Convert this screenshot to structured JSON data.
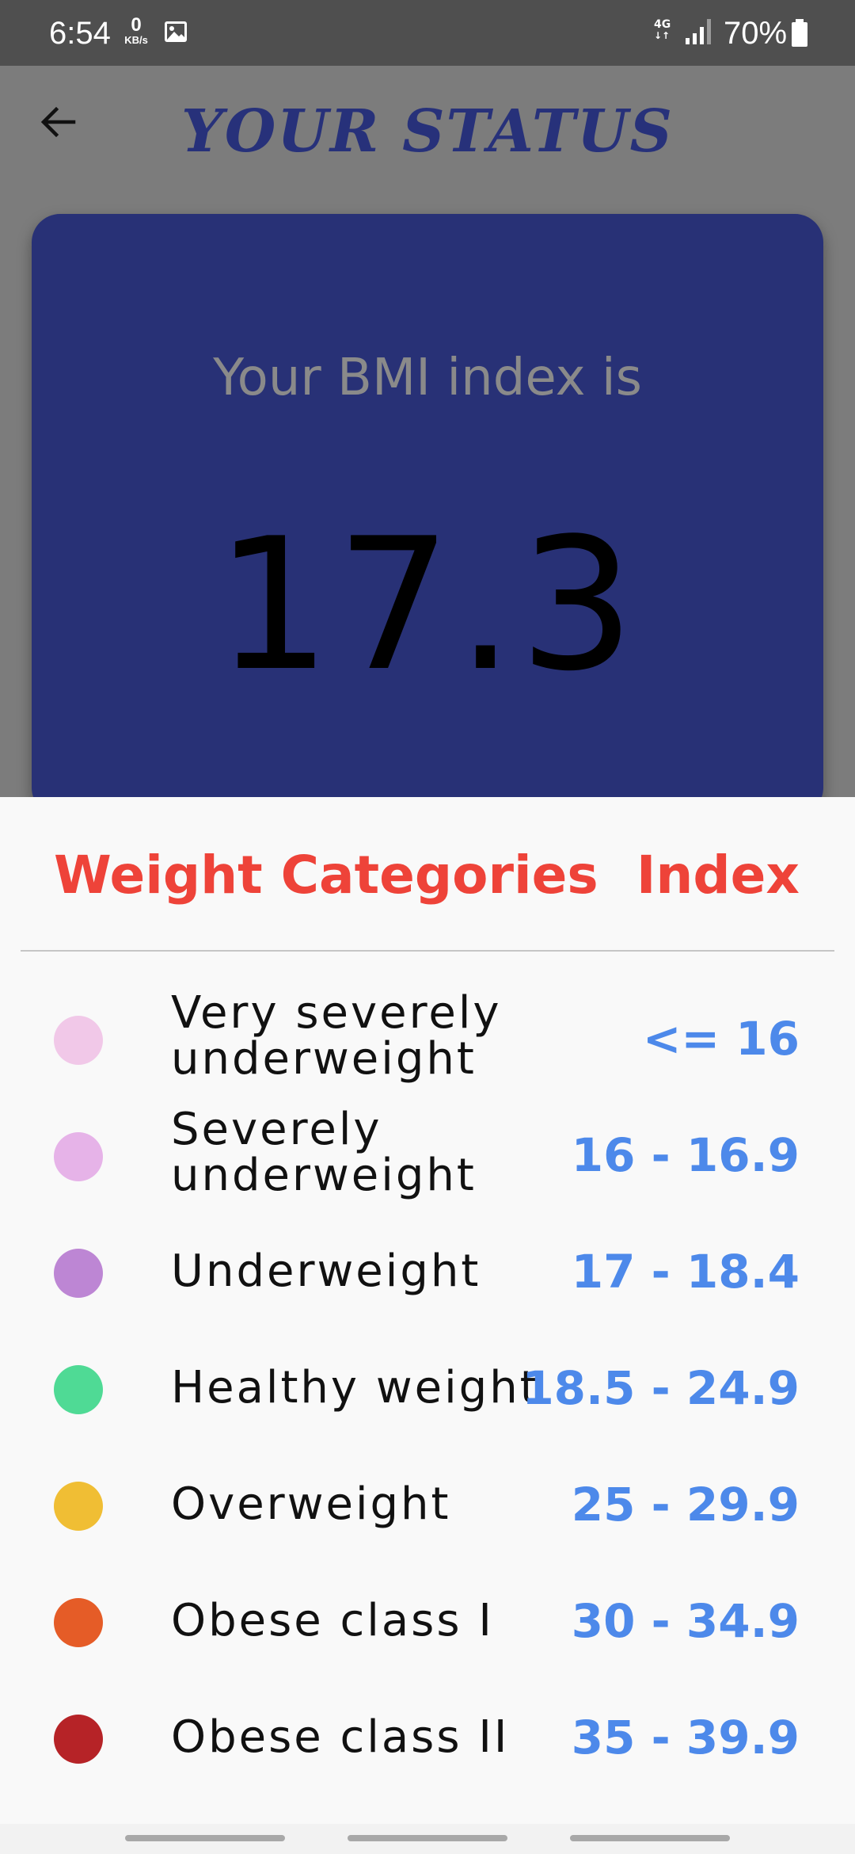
{
  "status_bar": {
    "time": "6:54",
    "net_speed_value": "0",
    "net_speed_unit": "KB/s",
    "network_type": "4G",
    "battery": "70%"
  },
  "app_bar": {
    "title": "YOUR STATUS",
    "back_icon": "arrow-back-icon"
  },
  "result": {
    "label": "Your BMI index is",
    "value": "17.3"
  },
  "categories_sheet": {
    "header_category": "Weight Categories",
    "header_index": "Index",
    "rows": [
      {
        "category": "Very severely underweight",
        "index": "<= 16",
        "color": "#f1c8e8"
      },
      {
        "category": "Severely underweight",
        "index": "16 - 16.9",
        "color": "#e6b3e8"
      },
      {
        "category": "Underweight",
        "index": "17 - 18.4",
        "color": "#bd86d4"
      },
      {
        "category": "Healthy weight",
        "index": "18.5 - 24.9",
        "color": "#4fda95"
      },
      {
        "category": "Overweight",
        "index": "25 - 29.9",
        "color": "#f0be34"
      },
      {
        "category": "Obese class I",
        "index": "30 - 34.9",
        "color": "#e55c27"
      },
      {
        "category": "Obese class II",
        "index": "35 - 39.9",
        "color": "#b62327"
      }
    ]
  },
  "colors": {
    "title": "#27317a",
    "card": "#283176",
    "header": "#ee4339",
    "index_text": "#4d89ea"
  }
}
